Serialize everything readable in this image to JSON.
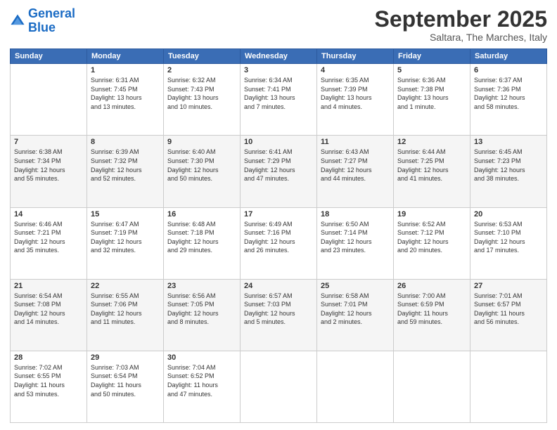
{
  "header": {
    "logo_line1": "General",
    "logo_line2": "Blue",
    "month": "September 2025",
    "location": "Saltara, The Marches, Italy"
  },
  "weekdays": [
    "Sunday",
    "Monday",
    "Tuesday",
    "Wednesday",
    "Thursday",
    "Friday",
    "Saturday"
  ],
  "weeks": [
    [
      {
        "day": "",
        "info": ""
      },
      {
        "day": "1",
        "info": "Sunrise: 6:31 AM\nSunset: 7:45 PM\nDaylight: 13 hours\nand 13 minutes."
      },
      {
        "day": "2",
        "info": "Sunrise: 6:32 AM\nSunset: 7:43 PM\nDaylight: 13 hours\nand 10 minutes."
      },
      {
        "day": "3",
        "info": "Sunrise: 6:34 AM\nSunset: 7:41 PM\nDaylight: 13 hours\nand 7 minutes."
      },
      {
        "day": "4",
        "info": "Sunrise: 6:35 AM\nSunset: 7:39 PM\nDaylight: 13 hours\nand 4 minutes."
      },
      {
        "day": "5",
        "info": "Sunrise: 6:36 AM\nSunset: 7:38 PM\nDaylight: 13 hours\nand 1 minute."
      },
      {
        "day": "6",
        "info": "Sunrise: 6:37 AM\nSunset: 7:36 PM\nDaylight: 12 hours\nand 58 minutes."
      }
    ],
    [
      {
        "day": "7",
        "info": "Sunrise: 6:38 AM\nSunset: 7:34 PM\nDaylight: 12 hours\nand 55 minutes."
      },
      {
        "day": "8",
        "info": "Sunrise: 6:39 AM\nSunset: 7:32 PM\nDaylight: 12 hours\nand 52 minutes."
      },
      {
        "day": "9",
        "info": "Sunrise: 6:40 AM\nSunset: 7:30 PM\nDaylight: 12 hours\nand 50 minutes."
      },
      {
        "day": "10",
        "info": "Sunrise: 6:41 AM\nSunset: 7:29 PM\nDaylight: 12 hours\nand 47 minutes."
      },
      {
        "day": "11",
        "info": "Sunrise: 6:43 AM\nSunset: 7:27 PM\nDaylight: 12 hours\nand 44 minutes."
      },
      {
        "day": "12",
        "info": "Sunrise: 6:44 AM\nSunset: 7:25 PM\nDaylight: 12 hours\nand 41 minutes."
      },
      {
        "day": "13",
        "info": "Sunrise: 6:45 AM\nSunset: 7:23 PM\nDaylight: 12 hours\nand 38 minutes."
      }
    ],
    [
      {
        "day": "14",
        "info": "Sunrise: 6:46 AM\nSunset: 7:21 PM\nDaylight: 12 hours\nand 35 minutes."
      },
      {
        "day": "15",
        "info": "Sunrise: 6:47 AM\nSunset: 7:19 PM\nDaylight: 12 hours\nand 32 minutes."
      },
      {
        "day": "16",
        "info": "Sunrise: 6:48 AM\nSunset: 7:18 PM\nDaylight: 12 hours\nand 29 minutes."
      },
      {
        "day": "17",
        "info": "Sunrise: 6:49 AM\nSunset: 7:16 PM\nDaylight: 12 hours\nand 26 minutes."
      },
      {
        "day": "18",
        "info": "Sunrise: 6:50 AM\nSunset: 7:14 PM\nDaylight: 12 hours\nand 23 minutes."
      },
      {
        "day": "19",
        "info": "Sunrise: 6:52 AM\nSunset: 7:12 PM\nDaylight: 12 hours\nand 20 minutes."
      },
      {
        "day": "20",
        "info": "Sunrise: 6:53 AM\nSunset: 7:10 PM\nDaylight: 12 hours\nand 17 minutes."
      }
    ],
    [
      {
        "day": "21",
        "info": "Sunrise: 6:54 AM\nSunset: 7:08 PM\nDaylight: 12 hours\nand 14 minutes."
      },
      {
        "day": "22",
        "info": "Sunrise: 6:55 AM\nSunset: 7:06 PM\nDaylight: 12 hours\nand 11 minutes."
      },
      {
        "day": "23",
        "info": "Sunrise: 6:56 AM\nSunset: 7:05 PM\nDaylight: 12 hours\nand 8 minutes."
      },
      {
        "day": "24",
        "info": "Sunrise: 6:57 AM\nSunset: 7:03 PM\nDaylight: 12 hours\nand 5 minutes."
      },
      {
        "day": "25",
        "info": "Sunrise: 6:58 AM\nSunset: 7:01 PM\nDaylight: 12 hours\nand 2 minutes."
      },
      {
        "day": "26",
        "info": "Sunrise: 7:00 AM\nSunset: 6:59 PM\nDaylight: 11 hours\nand 59 minutes."
      },
      {
        "day": "27",
        "info": "Sunrise: 7:01 AM\nSunset: 6:57 PM\nDaylight: 11 hours\nand 56 minutes."
      }
    ],
    [
      {
        "day": "28",
        "info": "Sunrise: 7:02 AM\nSunset: 6:55 PM\nDaylight: 11 hours\nand 53 minutes."
      },
      {
        "day": "29",
        "info": "Sunrise: 7:03 AM\nSunset: 6:54 PM\nDaylight: 11 hours\nand 50 minutes."
      },
      {
        "day": "30",
        "info": "Sunrise: 7:04 AM\nSunset: 6:52 PM\nDaylight: 11 hours\nand 47 minutes."
      },
      {
        "day": "",
        "info": ""
      },
      {
        "day": "",
        "info": ""
      },
      {
        "day": "",
        "info": ""
      },
      {
        "day": "",
        "info": ""
      }
    ]
  ]
}
